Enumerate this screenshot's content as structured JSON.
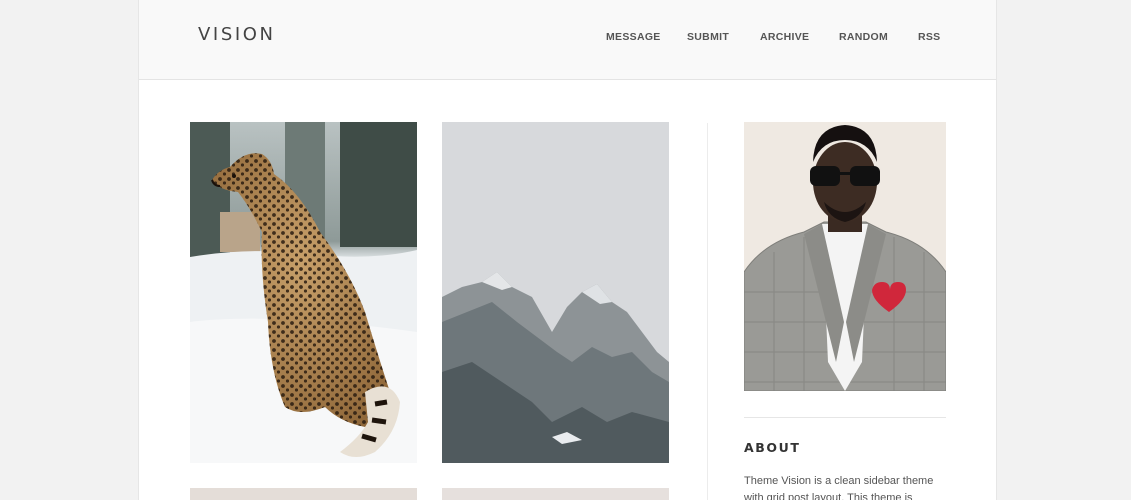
{
  "site": {
    "logo": "VISION"
  },
  "nav": {
    "items": [
      {
        "label": "MESSAGE"
      },
      {
        "label": "SUBMIT"
      },
      {
        "label": "ARCHIVE"
      },
      {
        "label": "RANDOM"
      },
      {
        "label": "RSS"
      }
    ]
  },
  "posts": [
    {
      "subject": "cheetah sitting in snow"
    },
    {
      "subject": "jagged mountain peaks"
    }
  ],
  "sidebar": {
    "avatar": "man in sunglasses and plaid blazer with red heart pin",
    "about_title": "ABOUT",
    "about_text": "Theme Vision is a clean sidebar theme with grid post layout. This theme is responsive"
  },
  "colors": {
    "page_bg": "#f2f2f2",
    "header_bg": "#f9f9f9",
    "text": "#444444"
  }
}
